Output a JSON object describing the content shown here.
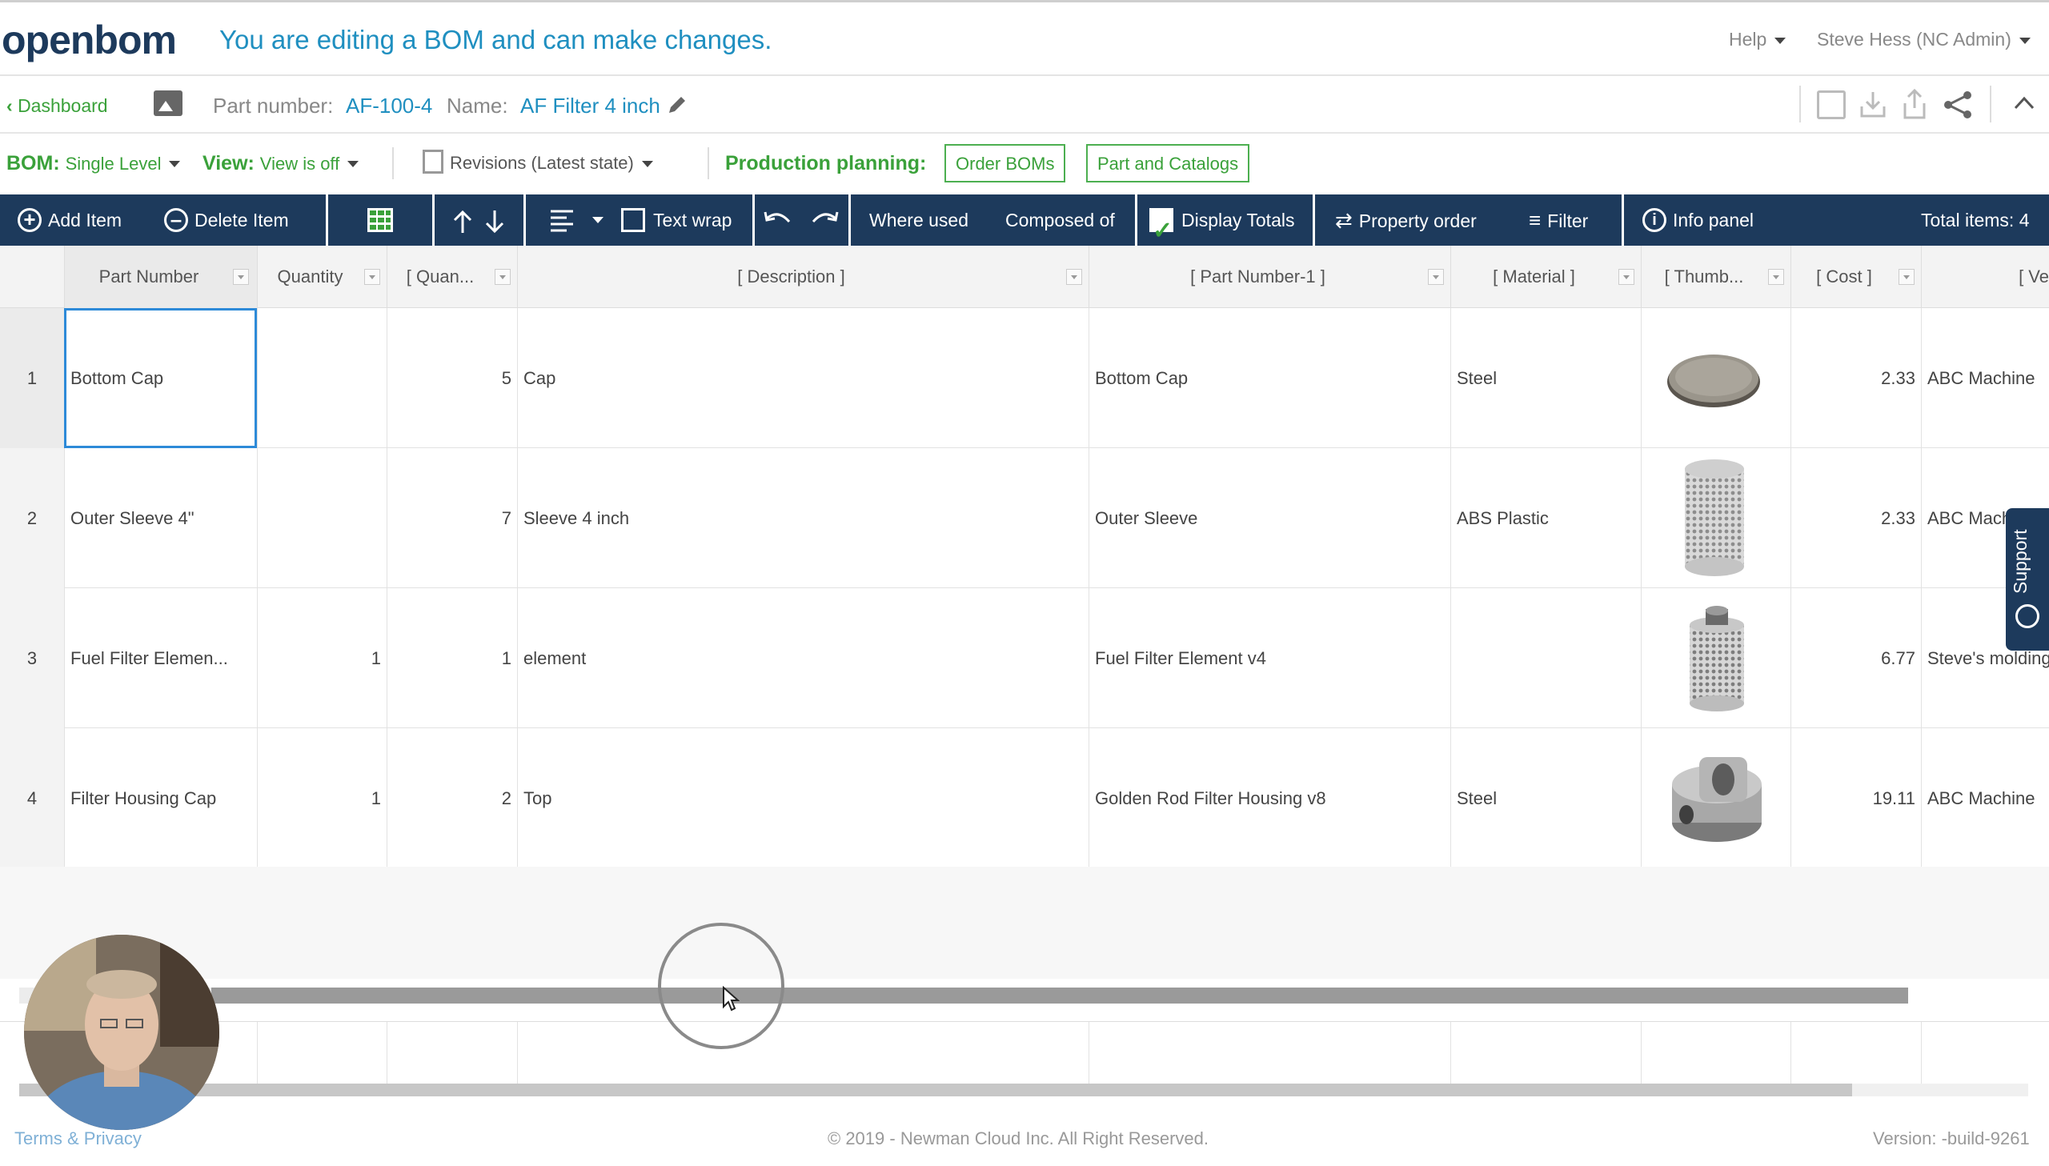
{
  "header": {
    "logo": "openbom",
    "edit_message": "You are editing a BOM and can make changes.",
    "help": "Help",
    "user": "Steve Hess (NC Admin)"
  },
  "partbar": {
    "back": "Dashboard",
    "part_number_label": "Part number:",
    "part_number": "AF-100-4",
    "name_label": "Name:",
    "name": "AF Filter 4 inch"
  },
  "bombar": {
    "bom_label": "BOM:",
    "bom_value": "Single Level",
    "view_label": "View:",
    "view_value": "View is off",
    "revisions": "Revisions (Latest state)",
    "production_label": "Production planning:",
    "order_boms": "Order BOMs",
    "part_catalogs": "Part and Catalogs"
  },
  "toolbar": {
    "add_item": "Add Item",
    "delete_item": "Delete Item",
    "text_wrap": "Text wrap",
    "where_used": "Where used",
    "composed_of": "Composed of",
    "display_totals": "Display Totals",
    "property_order": "Property order",
    "filter": "Filter",
    "info_panel": "Info panel",
    "total_items": "Total items: 4"
  },
  "table": {
    "columns": [
      "Part Number",
      "Quantity",
      "[ Quan...",
      "[ Description ]",
      "[ Part Number-1 ]",
      "[ Material ]",
      "[ Thumb...",
      "[ Cost ]",
      "[ Ve"
    ],
    "rows": [
      {
        "n": "1",
        "part": "Bottom Cap",
        "qty": "",
        "quan": "5",
        "desc": "Cap",
        "pn1": "Bottom Cap",
        "mat": "Steel",
        "thumb": "disc",
        "cost": "2.33",
        "vendor": "ABC Machine"
      },
      {
        "n": "2",
        "part": "Outer Sleeve 4\"",
        "qty": "",
        "quan": "7",
        "desc": "Sleeve 4 inch",
        "pn1": "Outer Sleeve",
        "mat": "ABS Plastic",
        "thumb": "mesh-cylinder",
        "cost": "2.33",
        "vendor": "ABC Mach"
      },
      {
        "n": "3",
        "part": "Fuel Filter Elemen...",
        "qty": "1",
        "quan": "1",
        "desc": "element",
        "pn1": "Fuel Filter Element v4",
        "mat": "",
        "thumb": "filter-element",
        "cost": "6.77",
        "vendor": "Steve's molding"
      },
      {
        "n": "4",
        "part": "Filter Housing Cap",
        "qty": "1",
        "quan": "2",
        "desc": "Top",
        "pn1": "Golden Rod Filter Housing v8",
        "mat": "Steel",
        "thumb": "housing-cap",
        "cost": "19.11",
        "vendor": "ABC Machine"
      }
    ]
  },
  "support": "Support",
  "footer": {
    "terms": "Terms & Privacy",
    "copyright": "© 2019 - Newman Cloud Inc. All Right Reserved.",
    "version": "Version: -build-9261"
  },
  "colors": {
    "navy": "#1d3a5c",
    "green": "#3aa13a",
    "blue_text": "#1f8fc0",
    "selection": "#2d8ad8"
  }
}
